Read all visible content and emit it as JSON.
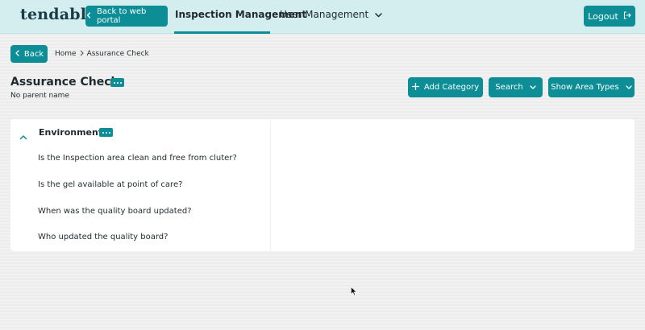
{
  "header": {
    "logo": "tendable",
    "back_portal_label": "Back to web portal",
    "tabs": [
      {
        "label": "Inspection Management",
        "active": true
      },
      {
        "label": "User Management",
        "active": false
      }
    ],
    "logout_label": "Logout"
  },
  "breadcrumb": {
    "back_label": "Back",
    "home": "Home",
    "current": "Assurance Check"
  },
  "page": {
    "title": "Assurance Check",
    "parent": "No parent name"
  },
  "actions": {
    "add_category": "Add Category",
    "search": "Search",
    "show_area_types": "Show Area Types"
  },
  "category": {
    "name": "Environment",
    "questions": [
      "Is the Inspection area clean and free from cluter?",
      "Is the gel available at point of care?",
      "When was the quality board updated?",
      "Who updated the quality board?"
    ]
  },
  "colors": {
    "accent": "#0d8e96",
    "header_bg": "#d4eeef",
    "logo": "#1b3a47"
  }
}
